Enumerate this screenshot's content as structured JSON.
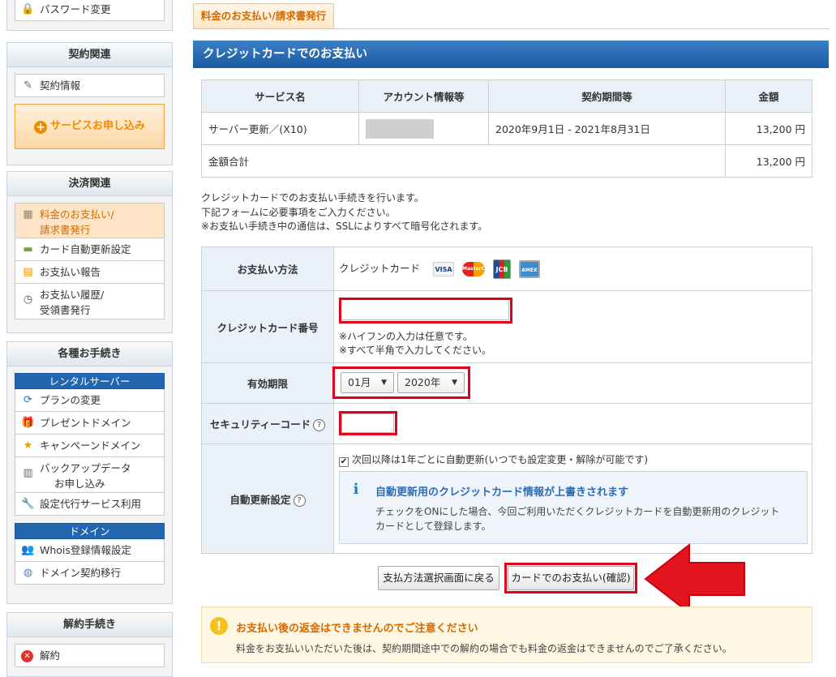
{
  "sidebar": {
    "password_change": "パスワード変更",
    "contract": {
      "heading": "契約関連",
      "contract_info": "契約情報",
      "apply_service": "サービスお申し込み"
    },
    "payment": {
      "heading": "決済関連",
      "invoice_line1": "料金のお支払い/",
      "invoice_line2": "請求書発行",
      "card_auto_renew": "カード自動更新設定",
      "payment_report": "お支払い報告",
      "history_line1": "お支払い履歴/",
      "history_line2": "受領書発行"
    },
    "procedures": {
      "heading": "各種お手続き",
      "rental_server": "レンタルサーバー",
      "plan_change": "プランの変更",
      "present_domain": "プレゼントドメイン",
      "campaign_domain": "キャンペーンドメイン",
      "backup_line1": "バックアップデータ",
      "backup_line2": "お申し込み",
      "proxy_service": "設定代行サービス利用",
      "domain": "ドメイン",
      "whois": "Whois登録情報設定",
      "domain_transfer": "ドメイン契約移行"
    },
    "cancel": {
      "heading": "解約手続き",
      "cancel": "解約"
    }
  },
  "main": {
    "tab_label": "料金のお支払い/請求書発行",
    "section_title": "クレジットカードでのお支払い",
    "service_table": {
      "headers": [
        "サービス名",
        "アカウント情報等",
        "契約期間等",
        "金額"
      ],
      "row": {
        "service": "サーバー更新／(X10)",
        "period": "2020年9月1日 - 2021年8月31日",
        "amount": "13,200 円"
      },
      "total_label": "金額合計",
      "total_amount": "13,200 円"
    },
    "notes": [
      "クレジットカードでのお支払い手続きを行います。",
      "下記フォームに必要事項をご入力ください。",
      "※お支払い手続き中の通信は、SSLによりすべて暗号化されます。"
    ],
    "form": {
      "payment_method_label": "お支払い方法",
      "payment_method_value": "クレジットカード",
      "card_brands": [
        "VISA",
        "MasterCard",
        "JCB",
        "AMEX"
      ],
      "card_number_label": "クレジットカード番号",
      "card_number_value": "",
      "card_hint1": "※ハイフンの入力は任意です。",
      "card_hint2": "※すべて半角で入力してください。",
      "expiry_label": "有効期限",
      "expiry_month": "01月",
      "expiry_year": "2020年",
      "security_label": "セキュリティーコード",
      "security_value": "",
      "auto_renew_label": "自動更新設定",
      "auto_renew_checkbox": "次回以降は1年ごとに自動更新(いつでも設定変更・解除が可能です)",
      "info_title": "自動更新用のクレジットカード情報が上書きされます",
      "info_text1": "チェックをONにした場合、今回ご利用いただくクレジットカードを自動更新用のクレジット",
      "info_text2": "カードとして登録します。"
    },
    "buttons": {
      "back": "支払方法選択画面に戻る",
      "confirm": "カードでのお支払い(確認)"
    },
    "warning": {
      "title": "お支払い後の返金はできませんのでご注意ください",
      "text": "料金をお支払いいただいた後は、契約期間途中での解約の場合でも料金の返金はできませんのでご了承ください。"
    }
  },
  "colors": {
    "accent_blue": "#1a5aa2",
    "highlight_red": "#e0001a",
    "orange": "#f08c00"
  }
}
